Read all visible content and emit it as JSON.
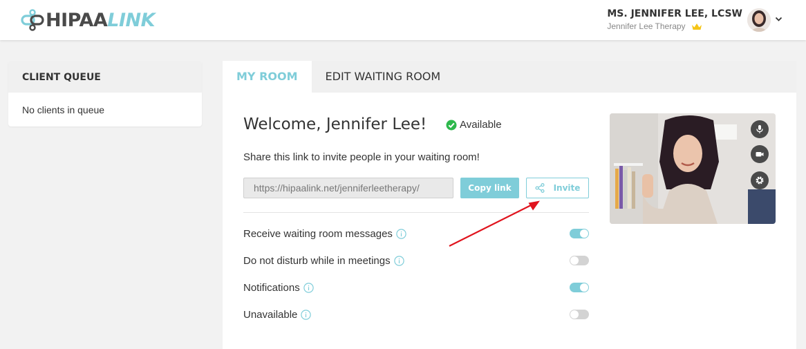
{
  "header": {
    "logo_primary": "HIPAA",
    "logo_secondary": "LINK",
    "user_name": "MS. JENNIFER LEE, LCSW",
    "user_org": "Jennifer Lee Therapy",
    "icons": {
      "logo": "link-chain-icon",
      "badge": "crown-icon",
      "menu": "chevron-down-icon"
    }
  },
  "queue": {
    "title": "CLIENT QUEUE",
    "empty_text": "No clients in queue"
  },
  "tabs": [
    {
      "label": "MY ROOM",
      "active": true
    },
    {
      "label": "EDIT WAITING ROOM",
      "active": false
    }
  ],
  "room": {
    "welcome": "Welcome, Jennifer Lee!",
    "status": "Available",
    "share_text": "Share this link to invite people in your waiting room!",
    "link_value": "https://hipaalink.net/jenniferleetherapy/",
    "copy_label": "Copy link",
    "invite_label": "Invite"
  },
  "settings": [
    {
      "label": "Receive waiting room messages",
      "enabled": true
    },
    {
      "label": "Do not disturb while in meetings",
      "enabled": false
    },
    {
      "label": "Notifications",
      "enabled": true
    },
    {
      "label": "Unavailable",
      "enabled": false
    }
  ],
  "video_controls": [
    "microphone-icon",
    "camera-icon",
    "settings-gear-icon"
  ],
  "colors": {
    "accent": "#7fcdd9",
    "status_green": "#2db84c",
    "annotation_red": "#e0141e",
    "crown_gold": "#f5c518"
  }
}
